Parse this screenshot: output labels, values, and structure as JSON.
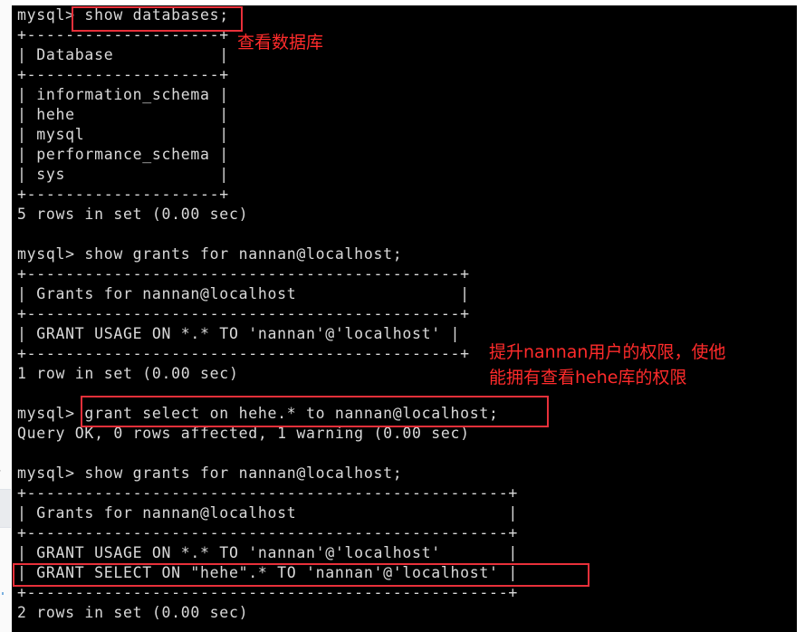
{
  "terminal": {
    "lines": [
      "mysql> show databases;",
      "+--------------------+",
      "| Database           |",
      "+--------------------+",
      "| information_schema |",
      "| hehe               |",
      "| mysql              |",
      "| performance_schema |",
      "| sys                |",
      "+--------------------+",
      "5 rows in set (0.00 sec)",
      "",
      "mysql> show grants for nannan@localhost;",
      "+---------------------------------------------+",
      "| Grants for nannan@localhost                 |",
      "+---------------------------------------------+",
      "| GRANT USAGE ON *.* TO 'nannan'@'localhost' |",
      "+---------------------------------------------+",
      "1 row in set (0.00 sec)",
      "",
      "mysql> grant select on hehe.* to nannan@localhost;",
      "Query OK, 0 rows affected, 1 warning (0.00 sec)",
      "",
      "mysql> show grants for nannan@localhost;",
      "+--------------------------------------------------+",
      "| Grants for nannan@localhost                      |",
      "+--------------------------------------------------+",
      "| GRANT USAGE ON *.* TO 'nannan'@'localhost'       |",
      "| GRANT SELECT ON \"hehe\".* TO 'nannan'@'localhost' |",
      "+--------------------------------------------------+",
      "2 rows in set (0.00 sec)"
    ]
  },
  "annotations": {
    "color": "#e8303a",
    "view_databases_label": "查看数据库",
    "grant_note_line1": "提升nannan用户的权限，使他",
    "grant_note_line2": "能拥有查看hehe库的权限"
  },
  "side": {
    "chevron_icon": "›"
  }
}
